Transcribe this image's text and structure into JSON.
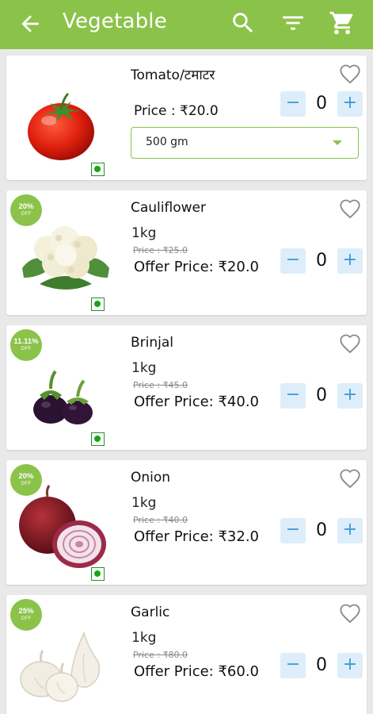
{
  "appbar": {
    "title": "Vegetable",
    "background": "#8bc34a",
    "icons": [
      "arrow-back-icon",
      "search-icon",
      "filter-icon",
      "cart-icon"
    ]
  },
  "products": [
    {
      "name": "Tomato/टमाटर",
      "price_label": "Price : ₹20.0",
      "variant": "500 gm",
      "qty": "0",
      "image": "tomato-image",
      "veg": true
    },
    {
      "name": "Cauliflower",
      "unit": "1kg",
      "mrp_label": "Price : ₹25.0",
      "offer_label": "Offer Price: ₹20.0",
      "discount": "20%",
      "off_text": "OFF",
      "qty": "0",
      "image": "cauliflower-image",
      "veg": true
    },
    {
      "name": "Brinjal",
      "unit": "1kg",
      "mrp_label": "Price : ₹45.0",
      "offer_label": "Offer Price: ₹40.0",
      "discount": "11.11%",
      "off_text": "OFF",
      "qty": "0",
      "image": "brinjal-image",
      "veg": true
    },
    {
      "name": "Onion",
      "unit": "1kg",
      "mrp_label": "Price : ₹40.0",
      "offer_label": "Offer Price: ₹32.0",
      "discount": "20%",
      "off_text": "OFF",
      "qty": "0",
      "image": "onion-image",
      "veg": true
    },
    {
      "name": "Garlic",
      "unit": "1kg",
      "mrp_label": "Price : ₹80.0",
      "offer_label": "Offer Price: ₹60.0",
      "discount": "25%",
      "off_text": "OFF",
      "qty": "0",
      "image": "garlic-image",
      "veg": true
    }
  ],
  "controls": {
    "minus": "−",
    "plus": "+"
  }
}
